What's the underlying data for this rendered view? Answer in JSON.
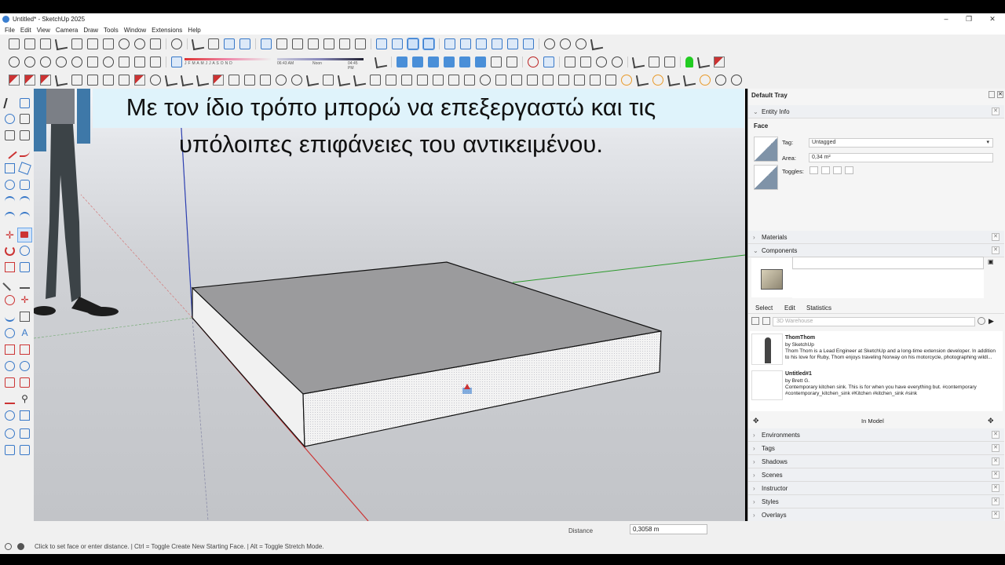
{
  "window": {
    "title": "Untitled* - SketchUp 2025",
    "minimize": "–",
    "maximize": "❐",
    "close": "✕"
  },
  "menu": [
    "File",
    "Edit",
    "View",
    "Camera",
    "Draw",
    "Tools",
    "Window",
    "Extensions",
    "Help"
  ],
  "shadow_bar": {
    "months": "J F M A M J J A S O N D",
    "time_start": "06:43 AM",
    "time_mid": "Noon",
    "time_end": "04:45 PM"
  },
  "caption": {
    "line1": "Με τον ίδιο τρόπο μπορώ να επεξεργαστώ και τις",
    "line2": "υπόλοιπες επιφάνειες του αντικειμένου."
  },
  "tray": {
    "title": "Default Tray",
    "entity_info": {
      "header": "Entity Info",
      "type": "Face",
      "tag_label": "Tag:",
      "tag_value": "Untagged",
      "area_label": "Area:",
      "area_value": "0,34 m²",
      "toggles_label": "Toggles:"
    },
    "materials": "Materials",
    "components": {
      "header": "Components",
      "tabs": [
        "Select",
        "Edit",
        "Statistics"
      ],
      "search_placeholder": "3D Warehouse",
      "items": [
        {
          "name": "ThomThom",
          "by": "by SketchUp",
          "desc": "Thom Thom is a Lead Engineer at SketchUp and a long-time extension developer. In addition to his love for Ruby, Thom enjoys traveling Norway on his motorcycle, photographing wildl..."
        },
        {
          "name": "Untitled#1",
          "by": "by Brett G.",
          "desc": "Contemporary kitchen sink. This is for when you have everything but. #contemporary #contemporary_kitchen_sink #Kitchen #kitchen_sink #sink"
        }
      ],
      "in_model": "In Model"
    },
    "panels": [
      "Environments",
      "Tags",
      "Shadows",
      "Scenes",
      "Instructor",
      "Styles",
      "Overlays"
    ]
  },
  "status": {
    "text": "Click to set face or enter distance. | Ctrl = Toggle Create New Starting Face. | Alt = Toggle Stretch Mode.",
    "distance_label": "Distance",
    "distance_value": "0,3058 m"
  }
}
